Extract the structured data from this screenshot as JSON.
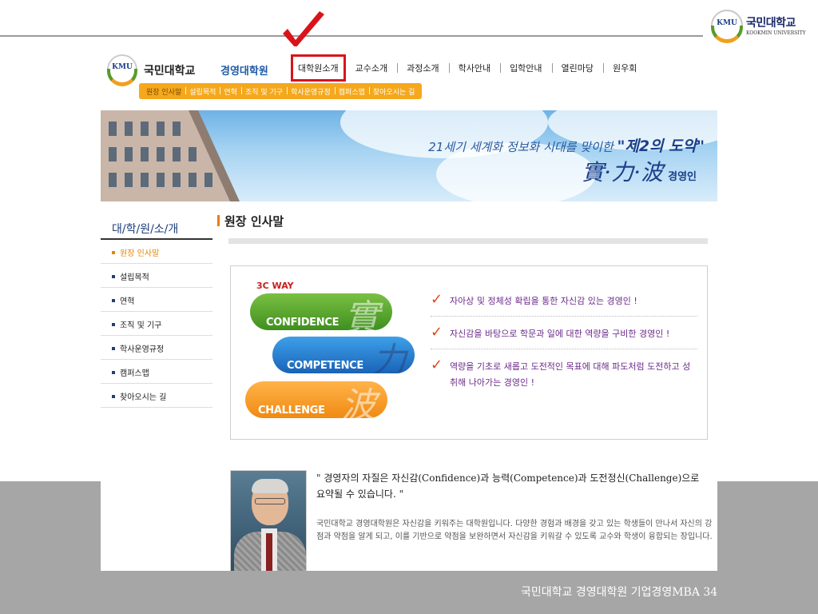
{
  "slide": {
    "corner_logo_kor": "국민대학교",
    "corner_logo_eng": "KOOKMIN UNIVERSITY",
    "corner_logo_mark": "KMU",
    "footer": "국민대학교 경영대학원 기업경영MBA 34",
    "checkmark_color": "#d8141a"
  },
  "site": {
    "logo_mark": "KMU",
    "university": "국민대학교",
    "graduate_school": "경영대학원"
  },
  "gnb": [
    {
      "label": "대학원소개",
      "active": true
    },
    {
      "label": "교수소개"
    },
    {
      "label": "과정소개"
    },
    {
      "label": "학사안내"
    },
    {
      "label": "입학안내"
    },
    {
      "label": "열린마당"
    },
    {
      "label": "원우회"
    }
  ],
  "subnav": [
    {
      "label": "원장 인사말",
      "active": true
    },
    {
      "label": "설립목적"
    },
    {
      "label": "연혁"
    },
    {
      "label": "조직 및 기구"
    },
    {
      "label": "학사운영규정"
    },
    {
      "label": "캠퍼스맵"
    },
    {
      "label": "찾아오시는 길"
    }
  ],
  "banner": {
    "slogan": "21세기 세계화 정보화 시대를 맞이한",
    "slogan_em": "\"제2의 도약\"",
    "hanja": "實·力·波",
    "hanja_suffix": "경영인"
  },
  "lnb": {
    "title": "대/학/원/소/개",
    "items": [
      {
        "label": "원장 인사말",
        "active": true
      },
      {
        "label": "설립목적"
      },
      {
        "label": "연혁"
      },
      {
        "label": "조직 및 기구"
      },
      {
        "label": "학사운영규정"
      },
      {
        "label": "캠퍼스맵"
      },
      {
        "label": "찾아오시는 길"
      }
    ]
  },
  "content": {
    "title": "원장 인사말",
    "way_label": "3C WAY",
    "pills": [
      {
        "word": "CONFIDENCE",
        "hanja": "實",
        "color": "#4a9e26"
      },
      {
        "word": "COMPETENCE",
        "hanja": "力",
        "color": "#1f72c4"
      },
      {
        "word": "CHALLENGE",
        "hanja": "波",
        "color": "#f29a1e"
      }
    ],
    "checks": [
      "자아상 및 정체성 확립을 통한 자신감 있는 경영인 !",
      "자신감을 바탕으로 학문과 일에 대한 역량을 구비한 경영인 !",
      "역량을 기초로 새롭고 도전적인 목표에 대해 파도처럼 도전하고 성취해 나아가는 경영인 !"
    ],
    "quote": "\" 경영자의 자질은 자신감(Confidence)과 능력(Competence)과 도전정신(Challenge)으로 요약될 수 있습니다. \"",
    "intro": "국민대학교 경영대학원은 자신감을 키워주는 대학원입니다. 다양한 경험과 배경을 갖고 있는 학생들이 만나서 자신의 강점과 약점을 알게 되고, 이를 기반으로 약점을 보완하면서 자신감을 키워갈 수 있도록 교수와 학생이 융합되는 장입니다."
  }
}
